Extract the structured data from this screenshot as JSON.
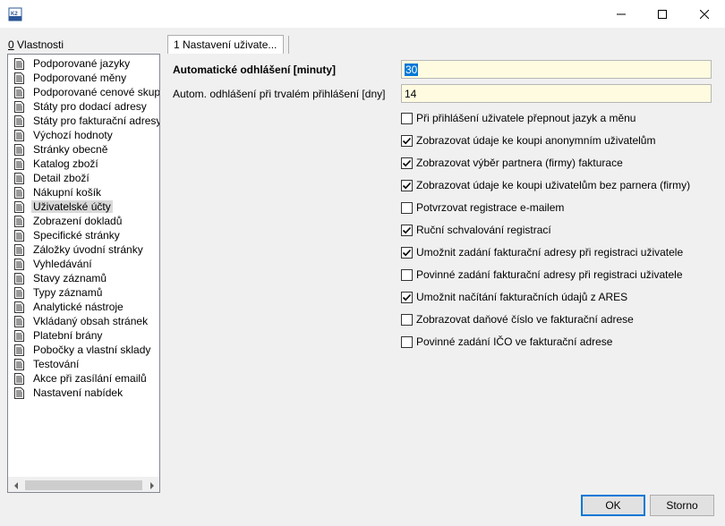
{
  "window": {
    "app_icon": "k2-icon"
  },
  "left_panel": {
    "label": "Vlastnosti",
    "label_key": "0",
    "items": [
      {
        "label": "Podporované jazyky"
      },
      {
        "label": "Podporované měny"
      },
      {
        "label": "Podporované cenové skupiny"
      },
      {
        "label": "Státy pro dodací adresy"
      },
      {
        "label": "Státy pro fakturační adresy"
      },
      {
        "label": "Výchozí hodnoty"
      },
      {
        "label": "Stránky obecně"
      },
      {
        "label": "Katalog zboží"
      },
      {
        "label": "Detail zboží"
      },
      {
        "label": "Nákupní košík"
      },
      {
        "label": "Uživatelské účty",
        "selected": true
      },
      {
        "label": "Zobrazení dokladů"
      },
      {
        "label": "Specifické stránky"
      },
      {
        "label": "Záložky úvodní stránky"
      },
      {
        "label": "Vyhledávání"
      },
      {
        "label": "Stavy záznamů"
      },
      {
        "label": "Typy záznamů"
      },
      {
        "label": "Analytické nástroje"
      },
      {
        "label": "Vkládaný obsah stránek"
      },
      {
        "label": "Platební brány"
      },
      {
        "label": "Pobočky a vlastní sklady"
      },
      {
        "label": "Testování"
      },
      {
        "label": "Akce při zasílání emailů"
      },
      {
        "label": "Nastavení nabídek"
      }
    ]
  },
  "tab": {
    "label": "1 Nastavení uživate..."
  },
  "fields": [
    {
      "label": "Automatické odhlášení [minuty]",
      "value": "30",
      "bold": true,
      "selected": true
    },
    {
      "label": "Autom. odhlášení při trvalém přihlášení [dny]",
      "value": "14",
      "bold": false,
      "selected": false
    }
  ],
  "checkboxes": [
    {
      "label": "Při přihlášení uživatele přepnout jazyk a měnu",
      "checked": false
    },
    {
      "label": "Zobrazovat údaje ke koupi anonymním uživatelům",
      "checked": true
    },
    {
      "label": "Zobrazovat výběr partnera (firmy) fakturace",
      "checked": true
    },
    {
      "label": "Zobrazovat údaje ke koupi uživatelům bez parnera (firmy)",
      "checked": true
    },
    {
      "label": "Potvrzovat registrace e-mailem",
      "checked": false
    },
    {
      "label": "Ruční schvalování registrací",
      "checked": true
    },
    {
      "label": "Umožnit zadání fakturační adresy při registraci uživatele",
      "checked": true
    },
    {
      "label": "Povinné zadání fakturační adresy při registraci uživatele",
      "checked": false
    },
    {
      "label": "Umožnit načítání fakturačních údajů z ARES",
      "checked": true
    },
    {
      "label": "Zobrazovat daňové číslo ve fakturační adrese",
      "checked": false
    },
    {
      "label": "Povinné zadání IČO ve fakturační adrese",
      "checked": false
    }
  ],
  "buttons": {
    "ok": "OK",
    "cancel": "Storno"
  },
  "colors": {
    "accent": "#0078d7",
    "input_bg": "#fffbe0",
    "selection_bg": "#d9d9d9"
  }
}
